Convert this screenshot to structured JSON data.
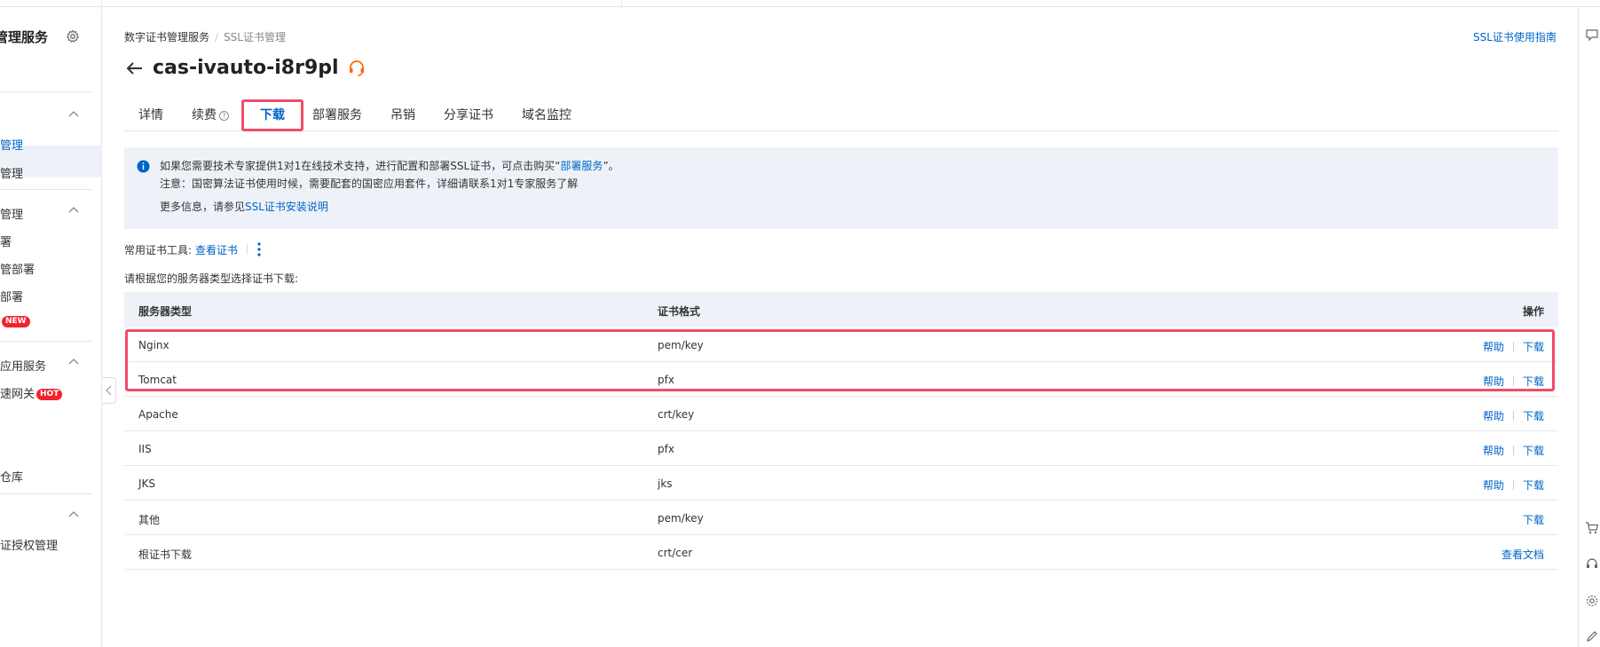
{
  "sidebar": {
    "title": "管理服务",
    "items": [
      {
        "label": "管理",
        "active": true
      },
      {
        "label": "管理",
        "active": false
      },
      {
        "label": "管理",
        "active": false
      },
      {
        "label": "署",
        "active": false
      },
      {
        "label": "管部署",
        "active": false
      },
      {
        "label": "部署",
        "active": false
      },
      {
        "label": "",
        "badge": "NEW",
        "active": false
      },
      {
        "label": "应用服务",
        "active": false
      },
      {
        "label": "速网关",
        "badge": "HOT",
        "active": false
      },
      {
        "label": "仓库",
        "active": false
      },
      {
        "label": "证授权管理",
        "active": false
      }
    ]
  },
  "breadcrumb": [
    "数字证书管理服务",
    "SSL证书管理"
  ],
  "guide_link": "SSL证书使用指南",
  "title": "cas-ivauto-i8r9pl",
  "tabs": [
    {
      "label": "详情",
      "active": false
    },
    {
      "label": "续费",
      "active": false,
      "help": true
    },
    {
      "label": "下载",
      "active": true
    },
    {
      "label": "部署服务",
      "active": false
    },
    {
      "label": "吊销",
      "active": false
    },
    {
      "label": "分享证书",
      "active": false
    },
    {
      "label": "域名监控",
      "active": false
    }
  ],
  "help_mark": "?",
  "notice": {
    "line1_prefix": "如果您需要技术专家提供1对1在线技术支持，进行配置和部署SSL证书，可点击购买“",
    "line1_link": "部署服务",
    "line1_suffix": "”。",
    "line2": "注意：国密算法证书使用时候，需要配套的国密应用套件，详细请联系1对1专家服务了解",
    "line3_prefix": "更多信息，请参见",
    "line3_link": "SSL证书安装说明"
  },
  "tools": {
    "label": "常用证书工具:",
    "link": "查看证书"
  },
  "choose_label": "请根据您的服务器类型选择证书下载:",
  "table": {
    "headers": {
      "server": "服务器类型",
      "format": "证书格式",
      "action": "操作"
    },
    "rows": [
      {
        "server": "Nginx",
        "format": "pem/key",
        "actions": [
          "帮助",
          "下载"
        ]
      },
      {
        "server": "Tomcat",
        "format": "pfx",
        "actions": [
          "帮助",
          "下载"
        ]
      },
      {
        "server": "Apache",
        "format": "crt/key",
        "actions": [
          "帮助",
          "下载"
        ]
      },
      {
        "server": "IIS",
        "format": "pfx",
        "actions": [
          "帮助",
          "下载"
        ]
      },
      {
        "server": "JKS",
        "format": "jks",
        "actions": [
          "帮助",
          "下载"
        ]
      },
      {
        "server": "其他",
        "format": "pem/key",
        "actions": [
          "下载"
        ]
      },
      {
        "server": "根证书下载",
        "format": "crt/cer",
        "actions": [
          "查看文档"
        ]
      }
    ]
  },
  "colors": {
    "accent": "#0064c8",
    "highlight": "#ef4d6a",
    "panel": "#eef2f8",
    "badge": "#f5222d",
    "support": "#ff6a00"
  }
}
